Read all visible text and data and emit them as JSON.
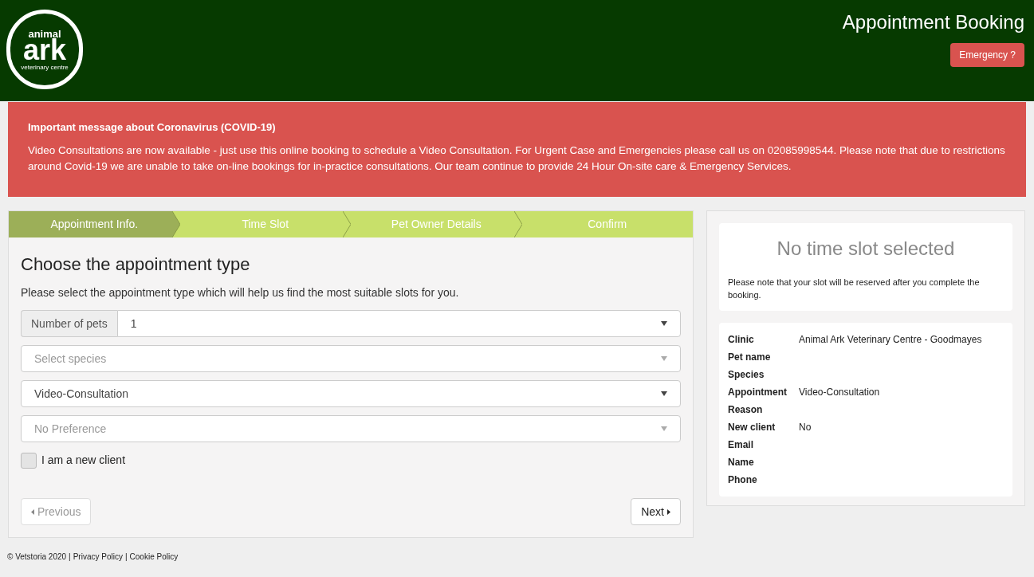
{
  "logo": {
    "line_1": "animal",
    "line_2": "ark",
    "line_3": "veterinary centre"
  },
  "header": {
    "title": "Appointment Booking",
    "emergency_button": "Emergency ?"
  },
  "notice": {
    "title": "Important message about Coronavirus (COVID-19)",
    "body": "Video Consultations are now available - just use this online booking to schedule a Video Consultation. For Urgent Case and Emergencies please call us on 02085998544. Please note that due to restrictions around Covid-19 we are unable to take on-line bookings for in-practice consultations. Our team continue to provide 24 Hour On-site care & Emergency Services."
  },
  "steps": [
    {
      "label": "Appointment Info.",
      "selected": true
    },
    {
      "label": "Time Slot",
      "selected": false
    },
    {
      "label": "Pet Owner Details",
      "selected": false
    },
    {
      "label": "Confirm",
      "selected": false
    }
  ],
  "form": {
    "heading": "Choose the appointment type",
    "intro": "Please select the appointment type which will help us find the most suitable slots for you.",
    "selects": [
      {
        "addon": "Number of pets",
        "value": "1"
      },
      {
        "placeholder": "Select species"
      },
      {
        "value": "Video-Consultation"
      },
      {
        "placeholder": "No Preference"
      }
    ],
    "new_client": {
      "label": "I am a new client",
      "checked": false
    },
    "previous": {
      "label": "Previous",
      "disabled": true
    },
    "next": {
      "label": "Next",
      "disabled": false
    }
  },
  "slot": {
    "title": "No time slot selected",
    "note": "Please note that your slot will be reserved after you complete the booking."
  },
  "summary": [
    {
      "label": "Clinic",
      "value": "Animal Ark Veterinary Centre - Goodmayes"
    },
    {
      "label": "Pet name"
    },
    {
      "label": "Species"
    },
    {
      "label": "Appointment",
      "value": "Video-Consultation"
    },
    {
      "label": "Reason"
    },
    {
      "label": "New client",
      "value": "No"
    },
    {
      "label": "Email"
    },
    {
      "label": "Name"
    },
    {
      "label": "Phone"
    }
  ],
  "footer": [
    {
      "kind": "text",
      "text": "© Vetstoria 2020"
    },
    {
      "kind": "separator",
      "text": "|"
    },
    {
      "kind": "link",
      "text": "Privacy Policy"
    },
    {
      "kind": "separator",
      "text": "|"
    },
    {
      "kind": "link",
      "text": "Cookie Policy"
    }
  ]
}
